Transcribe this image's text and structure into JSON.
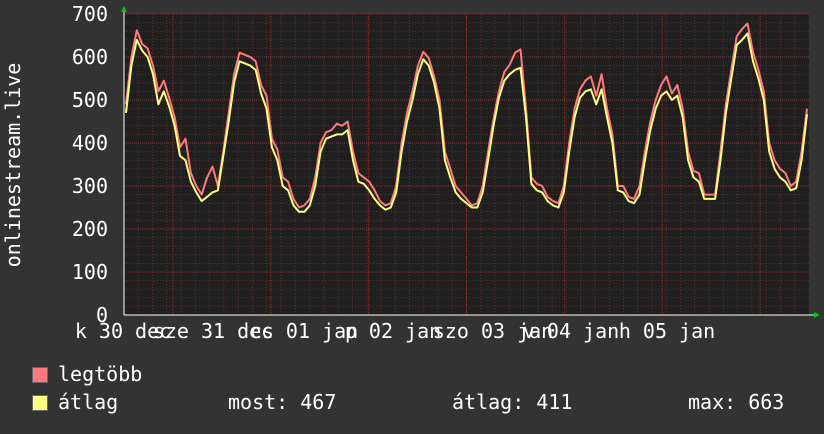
{
  "chart_data": {
    "type": "line",
    "ylabel": "onlinestream.live",
    "ylim": [
      0,
      700
    ],
    "y_ticks": [
      "0",
      "100",
      "200",
      "300",
      "400",
      "500",
      "600",
      "700"
    ],
    "x_ticks": [
      "k 30 dec",
      "sze 31 dec",
      "cs 01 jan",
      "p 02 jan",
      "szo 03 jan",
      "v 04 jan",
      "h 05 jan"
    ],
    "grid": true,
    "colors": {
      "background": "#333333",
      "plot_bg": "#1f1f1f",
      "grid": "#5a3030",
      "max": "#ff7a7a",
      "avg": "#ffff80"
    },
    "series": [
      {
        "name": "legtöbb",
        "color": "#ff7a7a",
        "values": [
          490,
          600,
          662,
          630,
          620,
          580,
          520,
          545,
          505,
          460,
          390,
          410,
          330,
          300,
          280,
          320,
          345,
          300,
          380,
          470,
          560,
          610,
          605,
          600,
          590,
          535,
          510,
          410,
          385,
          320,
          310,
          270,
          250,
          255,
          270,
          320,
          400,
          425,
          430,
          445,
          440,
          450,
          380,
          330,
          320,
          310,
          290,
          265,
          255,
          260,
          300,
          400,
          470,
          520,
          580,
          612,
          598,
          555,
          500,
          380,
          340,
          300,
          285,
          270,
          255,
          260,
          300,
          380,
          455,
          520,
          565,
          582,
          610,
          618,
          480,
          320,
          305,
          300,
          275,
          265,
          260,
          300,
          400,
          480,
          525,
          545,
          555,
          510,
          560,
          480,
          420,
          300,
          300,
          275,
          270,
          300,
          380,
          450,
          500,
          535,
          555,
          515,
          535,
          480,
          380,
          335,
          330,
          280,
          280,
          280,
          380,
          490,
          570,
          648,
          665,
          678,
          612,
          570,
          520,
          400,
          360,
          340,
          330,
          300,
          310,
          380,
          480
        ]
      },
      {
        "name": "átlag",
        "color": "#ffff80",
        "values": [
          470,
          580,
          640,
          615,
          600,
          560,
          490,
          520,
          485,
          440,
          370,
          360,
          310,
          285,
          265,
          275,
          285,
          290,
          370,
          450,
          540,
          590,
          585,
          580,
          570,
          515,
          480,
          390,
          360,
          300,
          290,
          255,
          240,
          240,
          255,
          300,
          380,
          410,
          415,
          420,
          420,
          430,
          360,
          310,
          305,
          290,
          270,
          255,
          245,
          250,
          285,
          380,
          450,
          500,
          560,
          595,
          580,
          540,
          480,
          360,
          320,
          285,
          270,
          260,
          250,
          250,
          285,
          360,
          440,
          505,
          545,
          560,
          570,
          575,
          460,
          305,
          290,
          285,
          265,
          255,
          250,
          285,
          380,
          460,
          505,
          520,
          525,
          490,
          525,
          460,
          400,
          290,
          285,
          265,
          260,
          280,
          360,
          430,
          480,
          510,
          520,
          500,
          510,
          460,
          360,
          320,
          310,
          270,
          270,
          270,
          360,
          470,
          550,
          628,
          640,
          655,
          590,
          550,
          500,
          380,
          340,
          320,
          310,
          290,
          295,
          360,
          467
        ]
      }
    ]
  },
  "legend": {
    "max_label": "legtöbb",
    "avg_label": "átlag",
    "most": "most: 467",
    "atlag": "átlag: 411",
    "max": "max: 663"
  }
}
